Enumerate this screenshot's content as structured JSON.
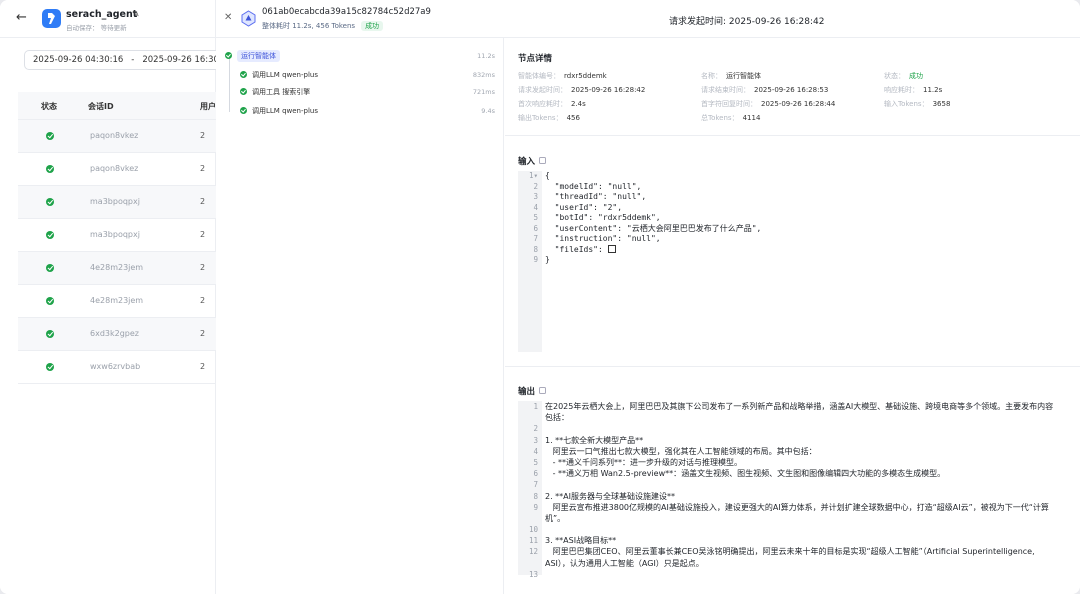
{
  "sidebar": {
    "app_name": "serach_agent",
    "autosave": "自动保存： 等待更新",
    "date_start": "2025-09-26 04:30:16",
    "date_sep": "-",
    "date_end": "2025-09-26 16:30:16",
    "columns": {
      "status": "状态",
      "session": "会话ID",
      "user": "用户"
    },
    "rows": [
      {
        "id": "paqon8vkez",
        "count": "2"
      },
      {
        "id": "paqon8vkez",
        "count": "2"
      },
      {
        "id": "ma3bpoqpxj",
        "count": "2"
      },
      {
        "id": "ma3bpoqpxj",
        "count": "2"
      },
      {
        "id": "4e28m23jem",
        "count": "2"
      },
      {
        "id": "4e28m23jem",
        "count": "2"
      },
      {
        "id": "6xd3k2gpez",
        "count": "2"
      },
      {
        "id": "wxw6zrvbab",
        "count": "2"
      }
    ]
  },
  "header": {
    "run_id": "061ab0ecabcda39a15c82784c52d27a9",
    "meta": "整体耗时 11.2s, 456 Tokens",
    "status": "成功",
    "request_time": "请求发起时间: 2025-09-26 16:28:42"
  },
  "tree": {
    "root": {
      "label": "运行智能体",
      "duration": "11.2s"
    },
    "children": [
      {
        "label": "调用LLM qwen-plus",
        "duration": "832ms"
      },
      {
        "label": "调用工具 搜索引擎",
        "duration": "721ms"
      },
      {
        "label": "调用LLM qwen-plus",
        "duration": "9.4s"
      }
    ]
  },
  "details": {
    "title": "节点详情",
    "fields": [
      {
        "k": "智能体编号：",
        "v": "rdxr5ddemk"
      },
      {
        "k": "名称：",
        "v": "运行智能体"
      },
      {
        "k": "状态：",
        "v": "成功"
      },
      {
        "k": "请求发起时间：",
        "v": "2025-09-26 16:28:42"
      },
      {
        "k": "请求结束时间：",
        "v": "2025-09-26 16:28:53"
      },
      {
        "k": "响应耗时：",
        "v": "11.2s"
      },
      {
        "k": "首次响应耗时：",
        "v": "2.4s"
      },
      {
        "k": "首字符回复时间：",
        "v": "2025-09-26 16:28:44"
      },
      {
        "k": "输入Tokens：",
        "v": "3658"
      },
      {
        "k": "输出Tokens：",
        "v": "456"
      },
      {
        "k": "总Tokens：",
        "v": "4114"
      }
    ]
  },
  "input": {
    "title": "输入",
    "lines": [
      "{",
      "  \"modelId\": \"null\",",
      "  \"threadId\": \"null\",",
      "  \"userId\": \"2\",",
      "  \"botId\": \"rdxr5ddemk\",",
      "  \"userContent\": \"云栖大会阿里巴巴发布了什么产品\",",
      "  \"instruction\": \"null\",",
      "  \"fileIds\": ",
      "}"
    ]
  },
  "output": {
    "title": "输出",
    "lines": [
      "在2025年云栖大会上，阿里巴巴及其旗下公司发布了一系列新产品和战略举措，涵盖AI大模型、基础设施、跨境电商等多个领域。主要发布内容包括：",
      "",
      "1. **七款全新大模型产品**",
      "   阿里云一口气推出七款大模型，强化其在人工智能领域的布局。其中包括：",
      "   - **通义千问系列**：进一步升级的对话与推理模型。",
      "   - **通义万相 Wan2.5-preview**：涵盖文生视频、图生视频、文生图和图像编辑四大功能的多模态生成模型。",
      "",
      "2. **AI服务器与全球基础设施建设**",
      "   阿里云宣布推进3800亿规模的AI基础设施投入，建设更强大的AI算力体系，并计划扩建全球数据中心，打造“超级AI云”，被视为下一代“计算机”。",
      "",
      "3. **ASI战略目标**",
      "   阿里巴巴集团CEO、阿里云董事长兼CEO吴泳铭明确提出，阿里云未来十年的目标是实现“超级人工智能”（Artificial Superintelligence, ASI），认为通用人工智能（AGI）只是起点。",
      ""
    ]
  },
  "colors": {
    "accent": "#3d53d9",
    "success": "#1fa34a",
    "brand": "#2f7cf6"
  }
}
